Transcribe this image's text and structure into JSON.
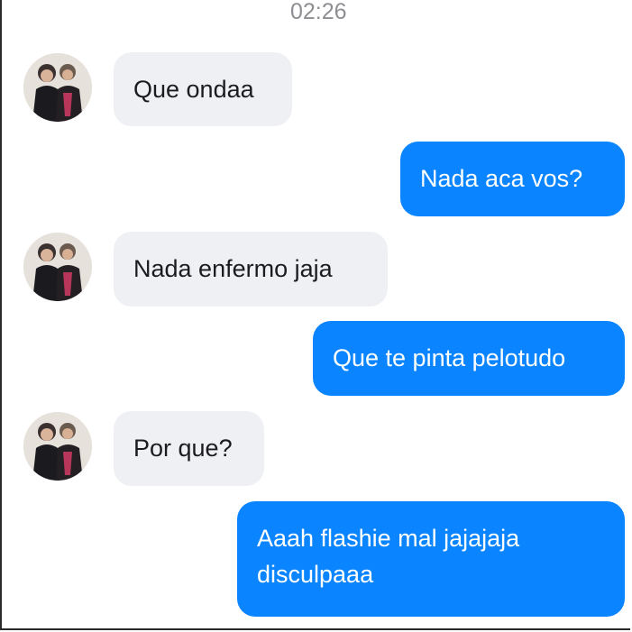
{
  "header": {
    "time": "02:26"
  },
  "messages": [
    {
      "side": "in",
      "text": "Que ondaa"
    },
    {
      "side": "out",
      "text": "Nada aca vos?"
    },
    {
      "side": "in",
      "text": "Nada enfermo jaja"
    },
    {
      "side": "out",
      "text": "Que te pinta pelotudo"
    },
    {
      "side": "in",
      "text": "Por que?"
    },
    {
      "side": "out",
      "text": "Aaah flashie mal jajajaja disculpaaa"
    }
  ],
  "colors": {
    "incoming_bubble": "#eff0f3",
    "outgoing_bubble": "#0a84ff",
    "timestamp": "#8e8e93"
  },
  "icons": {
    "contact_avatar": "contact-photo-avatar"
  }
}
